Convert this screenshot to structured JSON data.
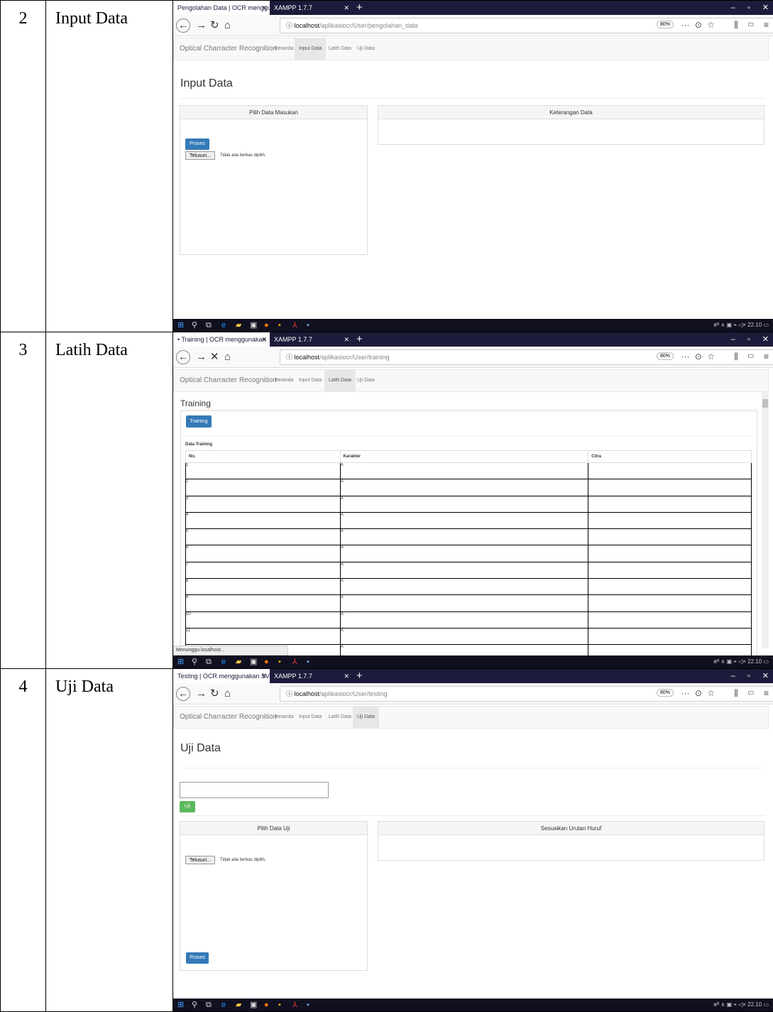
{
  "rows": [
    {
      "num": "2",
      "label": "Input Data",
      "tabs": [
        {
          "title": "Pengolahan Data | OCR menggun",
          "close": "✕"
        },
        {
          "title": "XAMPP 1.7.7",
          "close": "✕"
        }
      ],
      "url": {
        "host": "localhost",
        "path": "/aplikasiocr/User/pengolahan_data"
      },
      "zoom": "80%",
      "nav": {
        "brand": "Optical Charracter Recognition",
        "items": [
          "Beranda",
          "Input Data",
          "Latih Data",
          "Uji Data"
        ],
        "active": 1
      },
      "page_title": "Input Data",
      "left_panel": "Pilih Data Masukan",
      "right_panel": "Keterangan Data",
      "proses": "Proses",
      "browse": "Telusuri...",
      "no_file": "Tidak ada berkas dipilih."
    },
    {
      "num": "3",
      "label": "Latih Data",
      "tabs": [
        {
          "title": "• Training | OCR menggunakan",
          "close": "✕"
        },
        {
          "title": "XAMPP 1.7.7",
          "close": "✕"
        }
      ],
      "url": {
        "host": "localhost",
        "path": "/aplikasiocr/User/training"
      },
      "zoom": "80%",
      "nav": {
        "brand": "Optical Charracter Recognition",
        "items": [
          "Beranda",
          "Input Data",
          "Latih Data",
          "Uji Data"
        ],
        "active": 2
      },
      "page_title": "Training",
      "train_btn": "Training",
      "table_caption": "Data Training",
      "table_headers": [
        "No.",
        "Karakter",
        "Citra"
      ],
      "table_rows": [
        [
          "1",
          "A",
          ""
        ],
        [
          "2",
          "A",
          ""
        ],
        [
          "3",
          "A",
          ""
        ],
        [
          "4",
          "A",
          ""
        ],
        [
          "5",
          "A",
          ""
        ],
        [
          "6",
          "A",
          ""
        ],
        [
          "7",
          "A",
          ""
        ],
        [
          "8",
          "A",
          ""
        ],
        [
          "9",
          "A",
          ""
        ],
        [
          "10",
          "A",
          ""
        ],
        [
          "11",
          "A",
          ""
        ],
        [
          "",
          "A",
          ""
        ]
      ],
      "status": "Menunggu localhost..."
    },
    {
      "num": "4",
      "label": "Uji Data",
      "tabs": [
        {
          "title": "Testing | OCR menggunakan SVM",
          "close": "✕"
        },
        {
          "title": "XAMPP 1.7.7",
          "close": "✕"
        }
      ],
      "url": {
        "host": "localhost",
        "path": "/aplikasiocr/User/testing"
      },
      "zoom": "80%",
      "nav": {
        "brand": "Optical Charracter Recognition",
        "items": [
          "Beranda",
          "Input Data",
          "Latih Data",
          "Uji Data"
        ],
        "active": 3
      },
      "page_title": "Uji Data",
      "uji_btn": "Uji",
      "left_panel": "Pilih Data Uji",
      "right_panel": "Sesuaikan Urutan Huruf",
      "browse": "Telusuri...",
      "no_file": "Tidak ada berkas dipilih.",
      "proses": "Proses"
    }
  ],
  "taskbar": {
    "time": "22.10",
    "tray_icons": "ʀᴿ ∧ ▣ ⌖ ◁×"
  },
  "icons": {
    "windows": "windows-icon",
    "search": "search-icon",
    "taskview": "taskview-icon",
    "edge": "edge-icon",
    "explorer": "folder-icon",
    "store": "store-icon",
    "firefox": "firefox-icon",
    "app1": "app-icon",
    "acrobat": "acrobat-icon",
    "word": "word-icon"
  },
  "colors": {
    "tabbar": "#1c1b3b",
    "primary": "#337ab7",
    "success": "#5cb85c",
    "taskbar": "#101020"
  }
}
